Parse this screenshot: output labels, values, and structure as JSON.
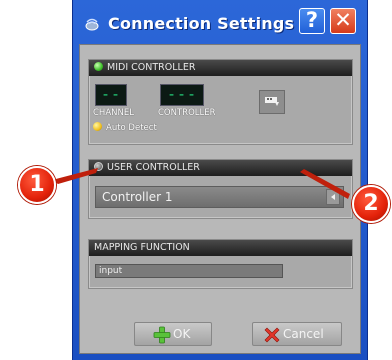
{
  "window": {
    "title": "Connection Settings",
    "help_glyph": "?",
    "close_glyph": "✕",
    "colors": {
      "titlebar": "#2c67d8",
      "client": "#b8b8b8",
      "section_header": "#1e1e1e"
    }
  },
  "midi_controller": {
    "header": "MIDI CONTROLLER",
    "channel_display": "--",
    "controller_display": "---",
    "channel_label": "CHANNEL",
    "controller_label": "CONTROLLER",
    "auto_detect_label": "Auto Detect",
    "status_led_color": "#3fbf2a",
    "icon": "assign-icon"
  },
  "user_controller": {
    "header": "USER CONTROLLER",
    "selected_option": "Controller 1"
  },
  "mapping_function": {
    "header": "MAPPING FUNCTION",
    "input_value": "input"
  },
  "footer": {
    "ok_label": "OK",
    "cancel_label": "Cancel"
  },
  "callouts": [
    "1",
    "2"
  ]
}
